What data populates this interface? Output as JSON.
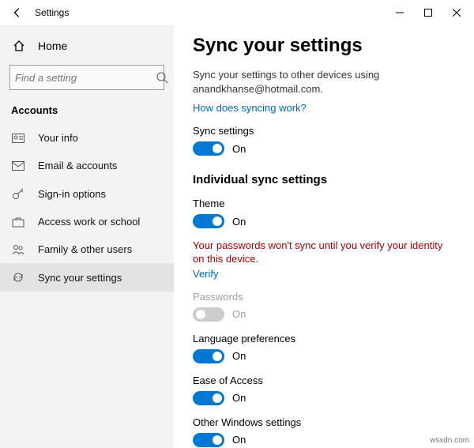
{
  "window": {
    "title": "Settings"
  },
  "sidebar": {
    "home": "Home",
    "search_placeholder": "Find a setting",
    "section": "Accounts",
    "items": [
      {
        "label": "Your info"
      },
      {
        "label": "Email & accounts"
      },
      {
        "label": "Sign-in options"
      },
      {
        "label": "Access work or school"
      },
      {
        "label": "Family & other users"
      },
      {
        "label": "Sync your settings"
      }
    ]
  },
  "main": {
    "heading": "Sync your settings",
    "desc": "Sync your settings to other devices using anandkhanse@hotmail.com.",
    "help_link": "How does syncing work?",
    "sync_label": "Sync settings",
    "on": "On",
    "off": "On",
    "individual_heading": "Individual sync settings",
    "theme_label": "Theme",
    "warning": "Your passwords won't sync until you verify your identity on this device.",
    "verify_link": "Verify",
    "passwords_label": "Passwords",
    "lang_label": "Language preferences",
    "ease_label": "Ease of Access",
    "other_label": "Other Windows settings"
  },
  "watermark": "wsxdn.com"
}
